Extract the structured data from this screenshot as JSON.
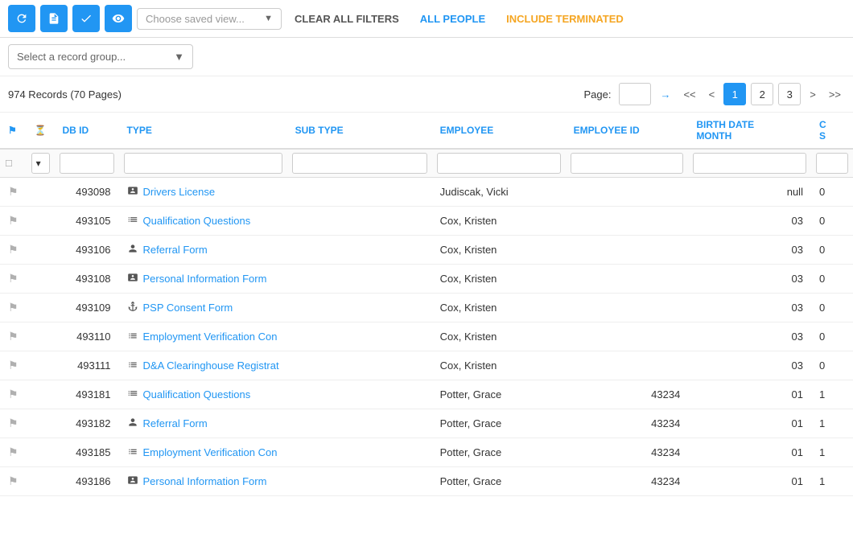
{
  "toolbar": {
    "refresh_label": "↺",
    "export_label": "✕",
    "check_label": "✔",
    "eye_label": "👁",
    "saved_view_placeholder": "Choose saved view...",
    "clear_filters_label": "CLEAR ALL FILTERS",
    "all_people_label": "ALL PEOPLE",
    "include_terminated_label": "INCLUDE TERMINATED"
  },
  "record_group": {
    "placeholder": "Select a record group..."
  },
  "pagination": {
    "records_label": "974 Records (70 Pages)",
    "page_label": "Page:",
    "current_page": "1",
    "pages": [
      "1",
      "2",
      "3"
    ],
    "first_label": "<<",
    "prev_label": "<",
    "next_label": ">",
    "last_label": ">>"
  },
  "table": {
    "headers": [
      {
        "key": "flag",
        "label": ""
      },
      {
        "key": "actions",
        "label": ""
      },
      {
        "key": "dbid",
        "label": "DB ID"
      },
      {
        "key": "type",
        "label": "TYPE"
      },
      {
        "key": "subtype",
        "label": "SUB TYPE"
      },
      {
        "key": "employee",
        "label": "EMPLOYEE"
      },
      {
        "key": "employee_id",
        "label": "EMPLOYEE ID"
      },
      {
        "key": "birth_date_month",
        "label": "BIRTH DATE MONTH"
      },
      {
        "key": "extra",
        "label": "C S"
      }
    ],
    "rows": [
      {
        "dbid": "493098",
        "type_icon": "id-card",
        "type": "Drivers License",
        "subtype": "",
        "employee": "Judiscak, Vicki",
        "employee_id": "",
        "birth_date_month": "null",
        "extra": "0"
      },
      {
        "dbid": "493105",
        "type_icon": "list",
        "type": "Qualification Questions",
        "subtype": "",
        "employee": "Cox, Kristen",
        "employee_id": "",
        "birth_date_month": "03",
        "extra": "0"
      },
      {
        "dbid": "493106",
        "type_icon": "user-tag",
        "type": "Referral Form",
        "subtype": "",
        "employee": "Cox, Kristen",
        "employee_id": "",
        "birth_date_month": "03",
        "extra": "0"
      },
      {
        "dbid": "493108",
        "type_icon": "id-card",
        "type": "Personal Information Form",
        "subtype": "",
        "employee": "Cox, Kristen",
        "employee_id": "",
        "birth_date_month": "03",
        "extra": "0"
      },
      {
        "dbid": "493109",
        "type_icon": "anchor",
        "type": "PSP Consent Form",
        "subtype": "",
        "employee": "Cox, Kristen",
        "employee_id": "",
        "birth_date_month": "03",
        "extra": "0"
      },
      {
        "dbid": "493110",
        "type_icon": "list-alt",
        "type": "Employment Verification Con",
        "subtype": "",
        "employee": "Cox, Kristen",
        "employee_id": "",
        "birth_date_month": "03",
        "extra": "0"
      },
      {
        "dbid": "493111",
        "type_icon": "list-alt",
        "type": "D&A Clearinghouse Registrat",
        "subtype": "",
        "employee": "Cox, Kristen",
        "employee_id": "",
        "birth_date_month": "03",
        "extra": "0"
      },
      {
        "dbid": "493181",
        "type_icon": "list",
        "type": "Qualification Questions",
        "subtype": "",
        "employee": "Potter, Grace",
        "employee_id": "43234",
        "birth_date_month": "01",
        "extra": "1"
      },
      {
        "dbid": "493182",
        "type_icon": "user-tag",
        "type": "Referral Form",
        "subtype": "",
        "employee": "Potter, Grace",
        "employee_id": "43234",
        "birth_date_month": "01",
        "extra": "1"
      },
      {
        "dbid": "493185",
        "type_icon": "list-alt",
        "type": "Employment Verification Con",
        "subtype": "",
        "employee": "Potter, Grace",
        "employee_id": "43234",
        "birth_date_month": "01",
        "extra": "1"
      },
      {
        "dbid": "493186",
        "type_icon": "id-card",
        "type": "Personal Information Form",
        "subtype": "",
        "employee": "Potter, Grace",
        "employee_id": "43234",
        "birth_date_month": "01",
        "extra": "1"
      }
    ],
    "icons": {
      "id-card": "🪪",
      "list": "≡",
      "user-tag": "👤",
      "anchor": "⚓",
      "list-alt": "☰"
    }
  }
}
